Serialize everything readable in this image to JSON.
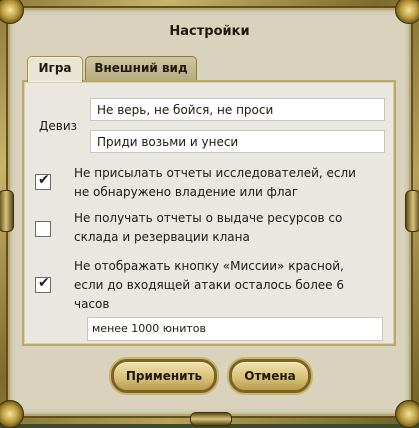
{
  "dialog": {
    "title": "Настройки"
  },
  "tabs": [
    {
      "label": "Игра",
      "active": true
    },
    {
      "label": "Внешний вид",
      "active": false
    }
  ],
  "motto": {
    "label": "Девиз",
    "line1": "Не верь, не бойся, не проси",
    "line2": "Приди возьми и унеси"
  },
  "options": [
    {
      "label": "Не присылать отчеты исследователей, если не обнаружено владение или флаг",
      "checked": true
    },
    {
      "label": "Не получать отчеты о выдаче ресурсов со склада и резервации клана",
      "checked": false
    },
    {
      "label": "Не отображать кнопку «Миссии» красной, если до входящей атаки осталось более 6 часов",
      "checked": true
    }
  ],
  "units_select": {
    "value": "менее 1000 юнитов"
  },
  "buttons": {
    "apply": "Применить",
    "cancel": "Отмена"
  },
  "colors": {
    "frame_gold": "#b8a25a",
    "panel_bg": "#e9e7df",
    "button_gold": "#d8c27a",
    "text": "#1e1a10"
  }
}
